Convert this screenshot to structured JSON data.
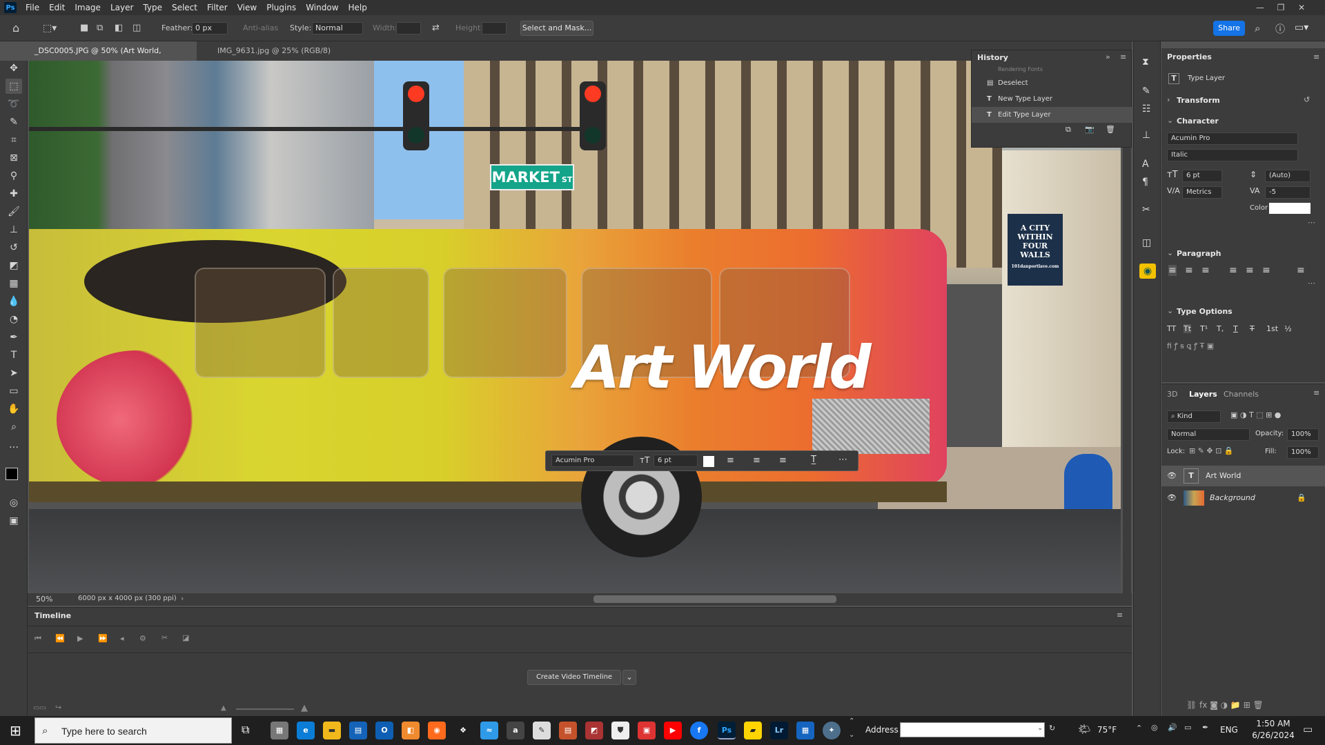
{
  "app": {
    "logo": "Ps"
  },
  "menubar": {
    "items": [
      "File",
      "Edit",
      "Image",
      "Layer",
      "Type",
      "Select",
      "Filter",
      "View",
      "Plugins",
      "Window",
      "Help"
    ]
  },
  "options": {
    "feather_label": "Feather:",
    "feather_value": "0 px",
    "antialias_label": "Anti-alias",
    "style_label": "Style:",
    "style_value": "Normal",
    "width_label": "Width:",
    "height_label": "Height:",
    "select_mask": "Select and Mask...",
    "share": "Share"
  },
  "tabs": [
    {
      "label": "_DSC0005.JPG @ 50% (Art World, RGB/8*) *",
      "active": true
    },
    {
      "label": "IMG_9631.jpg @ 25% (RGB/8)",
      "active": false
    }
  ],
  "canvas": {
    "art_text": "Art World",
    "sign": "MARKET",
    "sign_suffix": "ST",
    "poster": [
      "A CITY",
      "WITHIN",
      "FOUR",
      "WALLS"
    ],
    "poster_url": "101danportlave.com"
  },
  "context_bar": {
    "font": "Acumin Pro",
    "size": "6 pt"
  },
  "status": {
    "zoom": "50%",
    "doc_size": "6000 px x 4000 px (300 ppi)"
  },
  "timeline": {
    "title": "Timeline",
    "create_button": "Create Video Timeline"
  },
  "history": {
    "title": "History",
    "items": [
      "Deselect",
      "New Type Layer",
      "Edit Type Layer"
    ],
    "partial": "Rendering Fonts"
  },
  "properties": {
    "title": "Properties",
    "type_layer": "Type Layer",
    "transform": "Transform",
    "character": "Character",
    "font": "Acumin Pro",
    "style": "Italic",
    "size": "6 pt",
    "leading": "(Auto)",
    "kerning": "Metrics",
    "tracking": "-5",
    "color_label": "Color",
    "color_value": "#ffffff",
    "paragraph": "Paragraph",
    "type_options": "Type Options",
    "type_opts": [
      "TT",
      "Tt",
      "T¹",
      "T,",
      "T",
      "T",
      "1st",
      "½"
    ]
  },
  "layers": {
    "tabs": [
      "3D",
      "Layers",
      "Channels"
    ],
    "active_tab": "Layers",
    "kind": "Kind",
    "blend": "Normal",
    "opacity_label": "Opacity:",
    "opacity": "100%",
    "lock_label": "Lock:",
    "fill_label": "Fill:",
    "fill": "100%",
    "items": [
      {
        "name": "Art World",
        "type": "text",
        "selected": true
      },
      {
        "name": "Background",
        "type": "image",
        "locked": true
      }
    ]
  },
  "taskbar": {
    "search_placeholder": "Type here to search",
    "address_label": "Address",
    "weather": "75°F",
    "lang": "ENG",
    "time": "1:50 AM",
    "date": "6/26/2024"
  }
}
